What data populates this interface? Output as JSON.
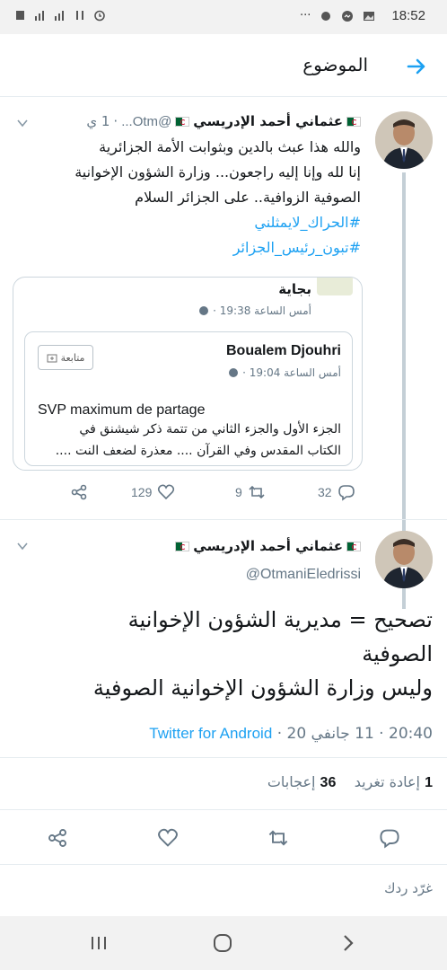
{
  "status_bar": {
    "time": "18:52"
  },
  "header": {
    "title": "الموضوع"
  },
  "thread_tweet": {
    "name": "عثماني أحمد الإدريسي",
    "handle_short": "@Otm...",
    "time_ago": "1 ي",
    "lines": [
      "والله هذا عبث بالدين وبثوابت الأمة الجزائرية",
      "إنا لله وإنا إليه راجعون... وزارة الشؤون الإخوانية",
      "الصوفية الزوافية.. على الجزائر السلام"
    ],
    "hashtags": [
      "#الحراك_لايمثلني",
      "#تبون_رئيس_الجزائر"
    ],
    "quote": {
      "page_name": "بجاية",
      "page_time": "أمس الساعة 19:38 ·",
      "author": "Boualem Djouhri",
      "author_time": "أمس الساعة 19:04 ·",
      "follow_label": "متابعة",
      "text_line_1": "SVP maximum de partage",
      "text_line_2": "الجزء الأول والجزء الثاني من تتمة ذكر شيشنق في",
      "text_line_3": "الكتاب المقدس وفي القرآن .... معذرة لضعف النت ...."
    },
    "actions": {
      "replies": "32",
      "retweets": "9",
      "likes": "129"
    }
  },
  "main_tweet": {
    "name": "عثماني أحمد الإدريسي",
    "handle": "@OtmaniEledrissi",
    "lines": [
      "تصحيح = مديرية الشؤون الإخوانية",
      "الصوفية",
      "وليس وزارة الشؤون الإخوانية الصوفية"
    ],
    "timestamp": "20:40 · 11 جانفي 20 ·",
    "source": "Twitter for Android",
    "retweet_count": "1",
    "retweet_label": "إعادة تغريد",
    "likes_count": "36",
    "likes_label": "إعجابات"
  },
  "reply_placeholder": "غرّد ردك",
  "icons": [
    "wifi-icon",
    "signal-icon",
    "battery-icon",
    "menu-icon",
    "back-arrow-icon",
    "share-icon",
    "heart-icon",
    "retweet-icon",
    "reply-icon",
    "chevron-down-icon",
    "globe-icon"
  ],
  "colors": {
    "accent": "#1da1f2",
    "muted": "#657786",
    "flag_green": "#006233",
    "flag_red": "#d21034"
  }
}
